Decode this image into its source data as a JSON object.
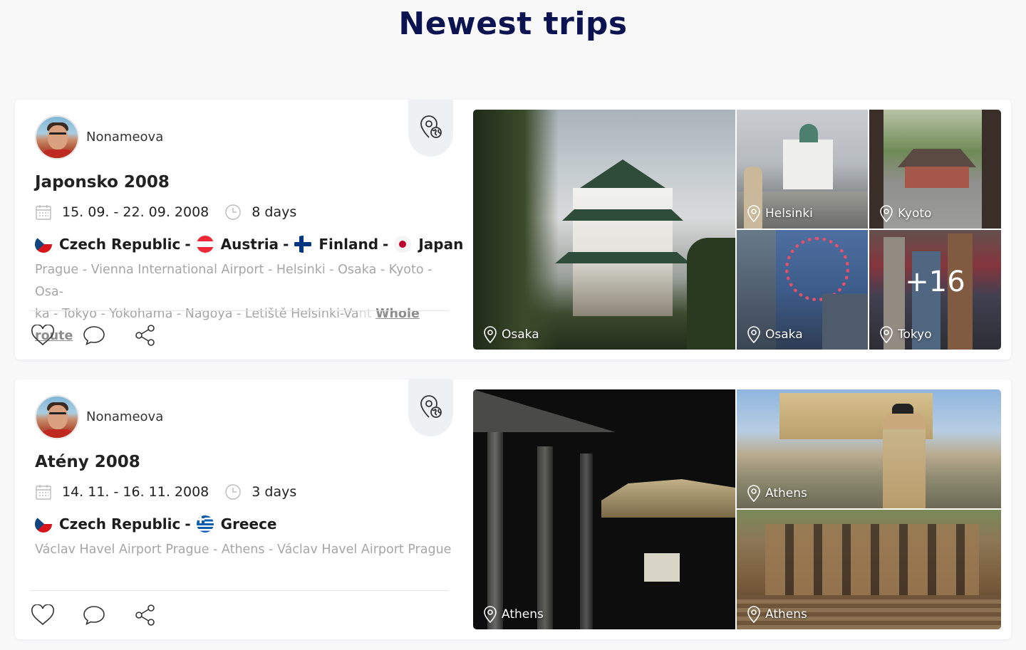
{
  "page": {
    "title": "Newest trips"
  },
  "trips": [
    {
      "user": "Nonameova",
      "title": "Japonsko 2008",
      "dates": "15. 09. - 22. 09. 2008",
      "duration": "8 days",
      "countries": [
        "Czech Republic",
        "Austria",
        "Finland",
        "Japan"
      ],
      "route_line1": "Prague - Vienna International Airport - Helsinki - Osaka - Kyoto - Osa-",
      "route_line2": "ka - Tokyo - Yokohama - Nagoya - Letiště Helsinki-Va",
      "route_faded": "nt",
      "route_link": "Whole route",
      "photos": [
        "Osaka",
        "Helsinki",
        "Kyoto",
        "Osaka",
        "Tokyo"
      ],
      "more_photos": "+16"
    },
    {
      "user": "Nonameova",
      "title": "Atény 2008",
      "dates": "14. 11. - 16. 11. 2008",
      "duration": "3 days",
      "countries": [
        "Czech Republic",
        "Greece"
      ],
      "route_line1": "Václav Havel Airport Prague - Athens - Václav Havel Airport Prague",
      "photos": [
        "Athens",
        "Athens",
        "Athens"
      ]
    }
  ],
  "icons": [
    "calendar-icon",
    "clock-icon",
    "heart-icon",
    "comment-icon",
    "share-icon",
    "map-pin-globe-icon",
    "location-pin-icon"
  ],
  "colors": {
    "title": "#0b1450",
    "route": "#a6a6a6",
    "background": "#f8f8f9"
  }
}
